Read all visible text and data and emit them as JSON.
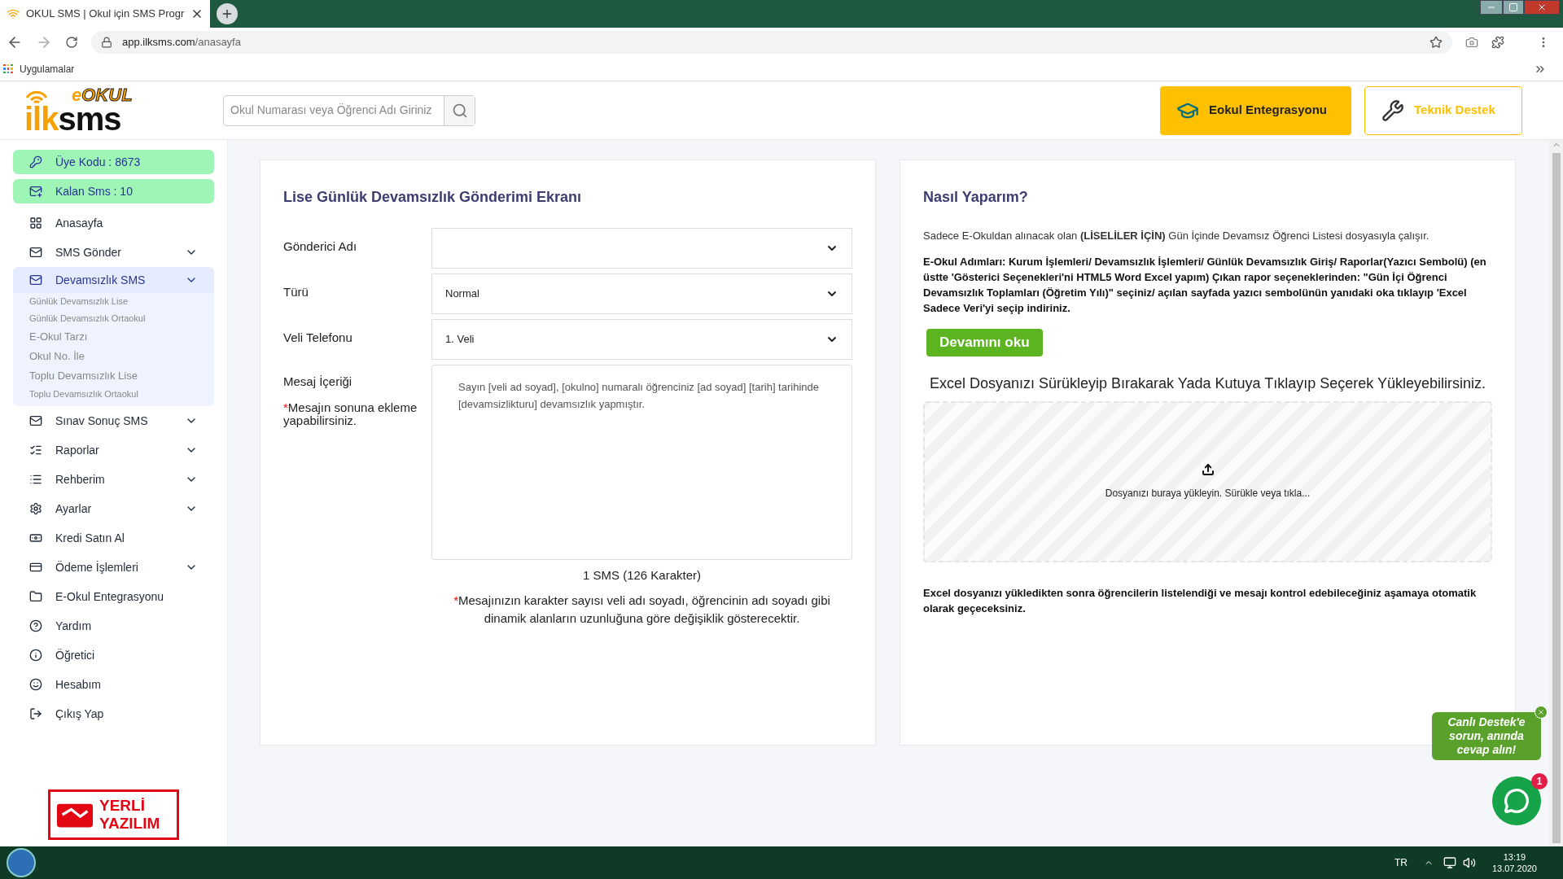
{
  "browser": {
    "tab_title": "OKUL SMS | Okul için SMS Progr",
    "url_host": "app.ilksms.com",
    "url_path": "/anasayfa",
    "bookmark": "Uygulamalar"
  },
  "header": {
    "logo": {
      "top_prefix": "e",
      "top": "OKUL",
      "main_a": "ilk",
      "main_b": "sms"
    },
    "search": {
      "placeholder": "Okul Numarası veya Öğrenci Adı Giriniz"
    },
    "buttons": [
      {
        "label": "Eokul Entegrasyonu",
        "kind": "filled"
      },
      {
        "label": "Teknik Destek",
        "kind": "outline"
      }
    ]
  },
  "sidebar": {
    "items": [
      {
        "label": "Üye Kodu : 8673",
        "kind": "badge",
        "selected": false
      },
      {
        "label": "Kalan Sms : 10",
        "kind": "badge",
        "selected": false
      },
      {
        "label": "Anasayfa",
        "kind": "link",
        "selected": false
      },
      {
        "label": "SMS Gönder",
        "kind": "menu",
        "selected": false
      },
      {
        "label": "Devamsızlık SMS",
        "kind": "menu",
        "selected": true,
        "children": [
          {
            "label": "Günlük Devamsızlık Lise",
            "kind": "small"
          },
          {
            "label": "Günlük Devamsızlık Ortaokul",
            "kind": "small"
          },
          {
            "label": "E-Okul Tarzı",
            "kind": "large"
          },
          {
            "label": "Okul No. İle",
            "kind": "large"
          },
          {
            "label": "Toplu Devamsızlık Lise",
            "kind": "large"
          },
          {
            "label": "Toplu Devamsızlık Ortaokul",
            "kind": "small"
          }
        ]
      },
      {
        "label": "Sınav Sonuç SMS",
        "kind": "menu",
        "selected": false
      },
      {
        "label": "Raporlar",
        "kind": "menu",
        "selected": false
      },
      {
        "label": "Rehberim",
        "kind": "menu",
        "selected": false
      },
      {
        "label": "Ayarlar",
        "kind": "menu",
        "selected": false
      },
      {
        "label": "Kredi Satın Al",
        "kind": "link",
        "selected": false
      },
      {
        "label": "Ödeme İşlemleri",
        "kind": "menu",
        "selected": false
      },
      {
        "label": "E-Okul Entegrasyonu",
        "kind": "link",
        "selected": false
      },
      {
        "label": "Yardım",
        "kind": "link",
        "selected": false
      },
      {
        "label": "Öğretici",
        "kind": "link",
        "selected": false
      },
      {
        "label": "Hesabım",
        "kind": "link",
        "selected": false
      },
      {
        "label": "Çıkış Yap",
        "kind": "link",
        "selected": false
      }
    ],
    "badge": {
      "line_1": "YERLİ",
      "line_2": "YAZILIM"
    }
  },
  "form": {
    "title": "Lise Günlük Devamsızlık Gönderimi Ekranı",
    "fields": [
      {
        "label": "Gönderici Adı"
      },
      {
        "label": "Türü",
        "value": "Normal"
      },
      {
        "label": "Veli Telefonu",
        "value": "1. Veli"
      }
    ],
    "message": {
      "label": "Mesaj İçeriği",
      "note_mark": "*",
      "note": "Mesajın sonuna ekleme yapabilirsiniz.",
      "text": "Sayın [veli ad soyad], [okulno] numaralı öğrenciniz [ad soyad] [tarih] tarihinde [devamsizlikturu] devamsızlık yapmıştır."
    },
    "counter": "1 SMS (126 Karakter)",
    "warning_mark": "*",
    "warning": "Mesajınızın karakter sayısı veli adı soyadı, öğrencinin adı soyadı gibi dinamik alanların uzunluğuna göre değişiklik gösterecektir."
  },
  "help": {
    "title": "Nasıl Yaparım?",
    "intro": "Sadece E-Okuldan alınacak olan **(LİSELİLER İÇİN)** Gün İçinde Devamsız Öğrenci Listesi dosyasıyla çalışır.",
    "steps": "E-Okul Adımları: Kurum İşlemleri/ Devamsızlık İşlemleri/ Günlük Devamsızlık Giriş/ Raporlar(Yazıcı Sembolü) (en üstte 'Gösterici Seçenekleri'ni HTML5 Word Excel yapım) Çıkan rapor seçeneklerinden: \"Gün İçi Öğrenci Devamsızlık Toplamları (Öğretim Yılı)\" seçiniz/ açılan sayfada yazıcı sembolünün yanıdaki oka tıklayıp 'Excel Sadece Veri'yi seçip indiriniz.",
    "read_more": "Devamını oku",
    "upload_title": "Excel Dosyanızı Sürükleyip Bırakarak Yada Kutuya Tıklayıp Seçerek Yükleyebilirsiniz.",
    "dropzone": "Dosyanızı buraya yükleyin. Sürükle veya tıkla...",
    "footer": "Excel dosyanızı yükledikten sonra öğrencilerin listelendiği ve mesajı kontrol edebileceğiniz aşamaya otomatik olarak geçeceksiniz."
  },
  "chat": {
    "bubble": "Canlı Destek'e sorun, anında cevap alın!",
    "unread": "1"
  },
  "taskbar": {
    "language": "TR",
    "time": "13:19",
    "date": "13.07.2020"
  }
}
